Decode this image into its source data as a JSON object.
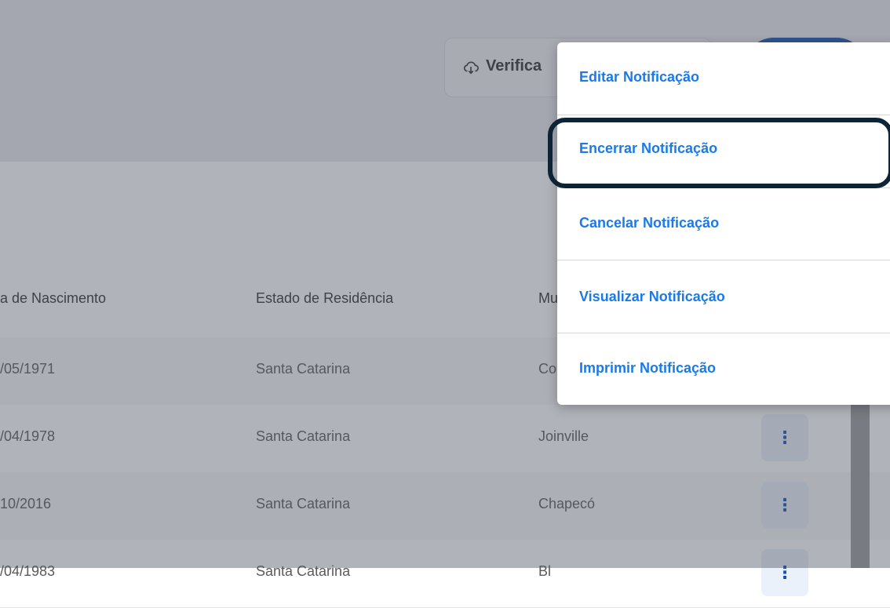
{
  "toolbar": {
    "verify_label": "Verifica",
    "verify_icon": "cloud-download-icon"
  },
  "table": {
    "columns": [
      "a de Nascimento",
      "Estado de Residência",
      "Mu"
    ],
    "rows": [
      {
        "birth": "/05/1971",
        "state": "Santa Catarina",
        "city": "Co"
      },
      {
        "birth": "/04/1978",
        "state": "Santa Catarina",
        "city": "Joinville"
      },
      {
        "birth": "10/2016",
        "state": "Santa Catarina",
        "city": "Chapecó"
      },
      {
        "birth": "/04/1983",
        "state": "Santa Catarina",
        "city": "Bl"
      }
    ],
    "action_icon": "kebab-menu-icon"
  },
  "menu": {
    "items": [
      {
        "label": "Editar Notificação"
      },
      {
        "label": "Encerrar Notificação"
      },
      {
        "label": "Cancelar Notificação"
      },
      {
        "label": "Visualizar Notificação"
      },
      {
        "label": "Imprimir Notificação"
      }
    ],
    "highlighted_item": "Encerrar Notificação"
  },
  "colors": {
    "menu_text": "#1a7ae8",
    "primary": "#1351b4",
    "highlight_ring": "#0d2436"
  }
}
